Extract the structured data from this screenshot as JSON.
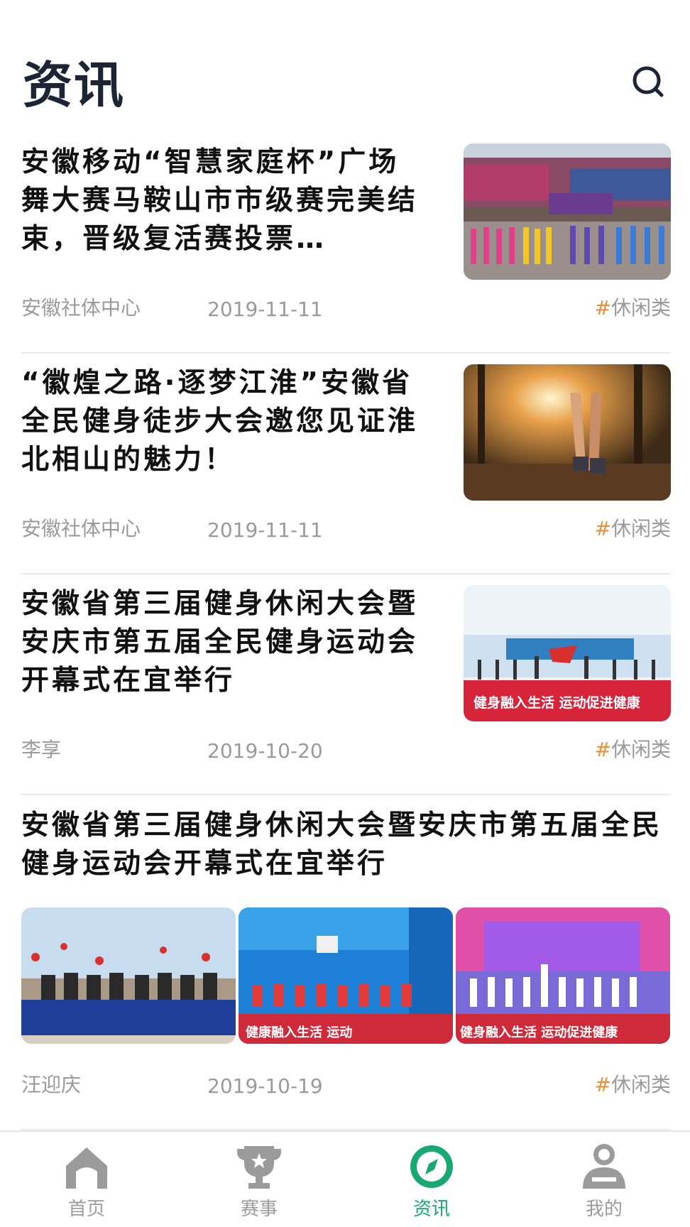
{
  "header": {
    "title": "资讯"
  },
  "feed": [
    {
      "title": "安徽移动“智慧家庭杯”广场舞大赛马鞍山市市级赛完美结束，晋级复活赛投票…",
      "source": "安徽社体中心",
      "date": "2019-11-11",
      "tag_hash": "#",
      "tag": "休闲类"
    },
    {
      "title": "“徽煌之路·逐梦江淮”安徽省全民健身徒步大会邀您见证淮北相山的魅力！",
      "source": "安徽社体中心",
      "date": "2019-11-11",
      "tag_hash": "#",
      "tag": "休闲类"
    },
    {
      "title": "安徽省第三届健身休闲大会暨安庆市第五届全民健身运动会开幕式在宜举行",
      "source": "李享",
      "date": "2019-10-20",
      "tag_hash": "#",
      "tag": "休闲类",
      "banner": "健身融入生活 运动促进健康"
    },
    {
      "title": "安徽省第三届健身休闲大会暨安庆市第五届全民健身运动会开幕式在宜举行",
      "source": "汪迎庆",
      "date": "2019-10-19",
      "tag_hash": "#",
      "tag": "休闲类",
      "banner_left": "健康融入生活 运动",
      "banner_right": "健身融入生活 运动促进健康"
    }
  ],
  "tabbar": [
    {
      "label": "首页",
      "icon": "home-icon",
      "active": false
    },
    {
      "label": "赛事",
      "icon": "trophy-icon",
      "active": false
    },
    {
      "label": "资讯",
      "icon": "compass-icon",
      "active": true
    },
    {
      "label": "我的",
      "icon": "user-icon",
      "active": false
    }
  ],
  "colors": {
    "accent": "#18a873",
    "tag_hash": "#e8913b",
    "title": "#1d2535"
  }
}
